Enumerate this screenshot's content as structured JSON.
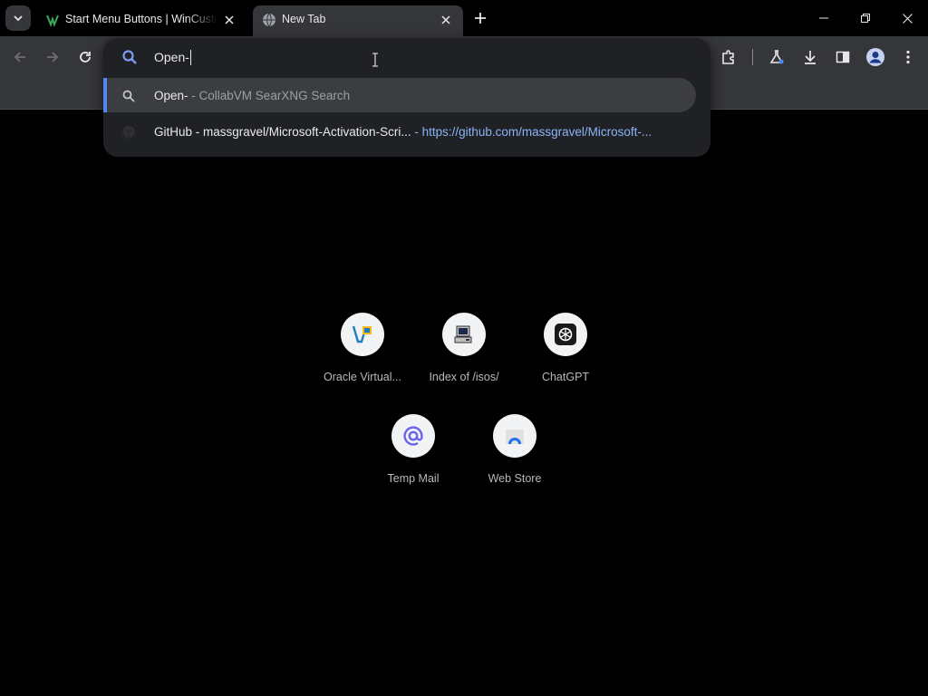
{
  "tabs": [
    {
      "title": "Start Menu Buttons | WinCustomize",
      "favicon": "wincustomize-favicon-icon",
      "active": false
    },
    {
      "title": "New Tab",
      "favicon": "globe-icon",
      "active": true
    }
  ],
  "omnibox": {
    "input_value": "Open-",
    "suggestions": [
      {
        "main": "Open-",
        "sub": " - CollabVM SearXNG Search",
        "icon": "search-icon"
      },
      {
        "main": "GitHub - massgravel/Microsoft-Activation-Scri...",
        "sub": " - ",
        "url": "https://github.com/massgravel/Microsoft-...",
        "icon": "github-icon"
      }
    ]
  },
  "shortcuts": [
    {
      "label": "Oracle Virtual...",
      "icon": "virtualbox-icon"
    },
    {
      "label": "Index of /isos/",
      "icon": "computer-icon"
    },
    {
      "label": "ChatGPT",
      "icon": "chatgpt-icon"
    },
    {
      "label": "Temp Mail",
      "icon": "at-sign-icon"
    },
    {
      "label": "Web Store",
      "icon": "webstore-icon"
    }
  ],
  "colors": {
    "accent": "#4d88f5",
    "toolbar": "#35363a",
    "url": "#8ab4f8"
  }
}
